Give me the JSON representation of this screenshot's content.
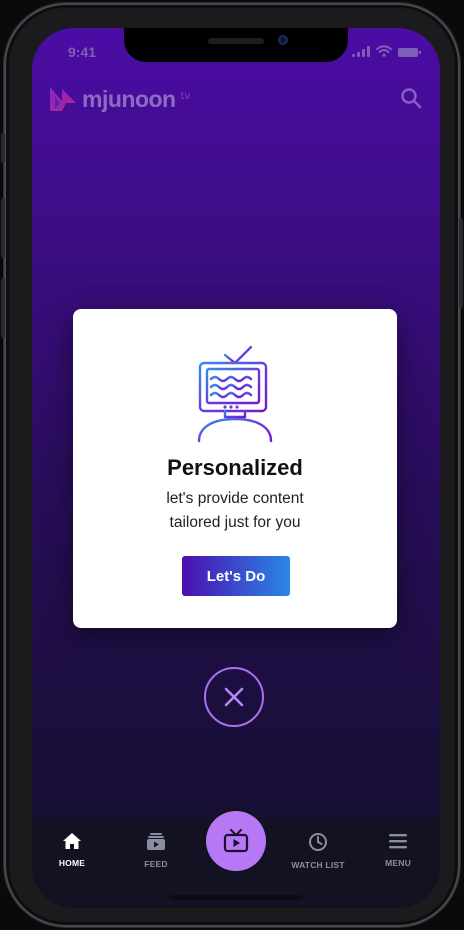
{
  "status_bar": {
    "time": "9:41"
  },
  "header": {
    "logo_text": "mjunoon",
    "logo_suffix": "tv"
  },
  "modal": {
    "title": "Personalized",
    "description_line1": "let's provide content",
    "description_line2": "tailored just for you",
    "cta_label": "Let's Do"
  },
  "tabbar": {
    "items": [
      {
        "label": "HOME",
        "icon": "home-icon",
        "active": true
      },
      {
        "label": "FEED",
        "icon": "feed-icon",
        "active": false
      },
      {
        "label": "",
        "icon": "tv-play-icon",
        "active": false
      },
      {
        "label": "WATCH LIST",
        "icon": "clock-icon",
        "active": false
      },
      {
        "label": "MENU",
        "icon": "menu-icon",
        "active": false
      }
    ]
  },
  "colors": {
    "accent_purple": "#b778f5",
    "gradient_start": "#4b0fb0",
    "gradient_end": "#2b86e6",
    "tabbar_bg": "#121222"
  }
}
